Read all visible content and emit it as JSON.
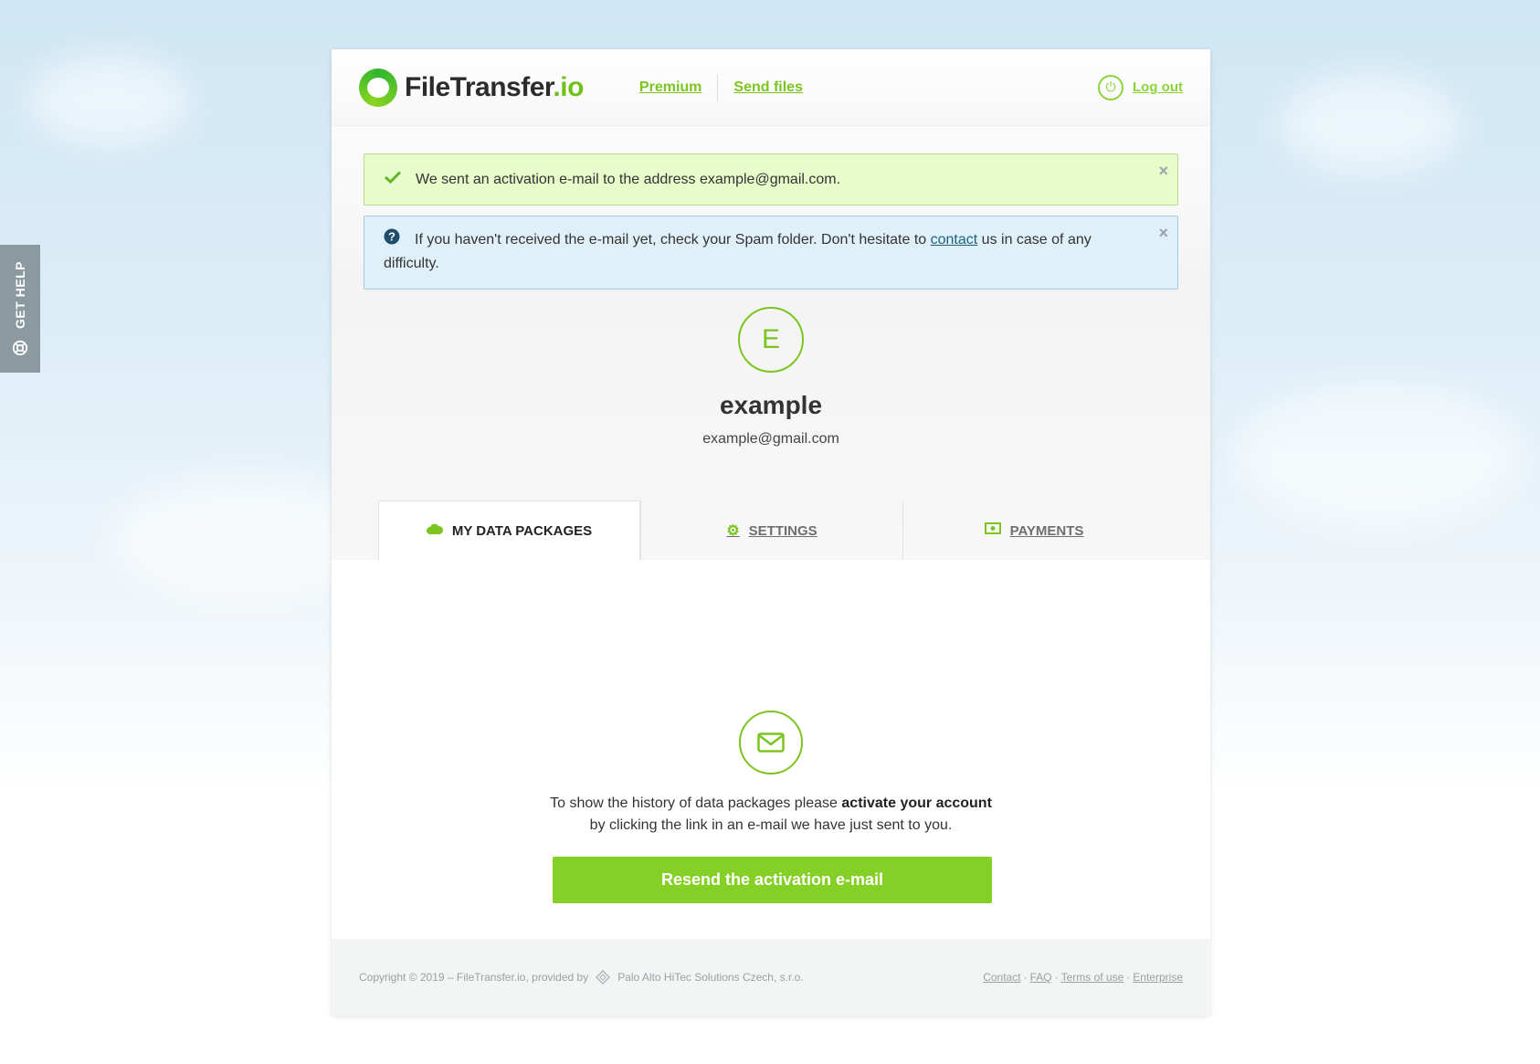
{
  "help_tab": {
    "label": "GET HELP"
  },
  "header": {
    "logo_main": "FileTransfer",
    "logo_suffix": ".io",
    "nav": {
      "premium": "Premium",
      "send_files": "Send files"
    },
    "logout": "Log out"
  },
  "alerts": {
    "success": {
      "text": "We sent an activation e-mail to the address example@gmail.com.",
      "close": "×"
    },
    "info": {
      "before": "If you haven't received the e-mail yet, check your Spam folder. Don't hesitate to ",
      "link": "contact",
      "after": " us in case of any difficulty.",
      "close": "×"
    }
  },
  "profile": {
    "initial": "E",
    "name": "example",
    "email": "example@gmail.com"
  },
  "tabs": [
    {
      "label": "MY DATA PACKAGES",
      "icon": "cloud-icon"
    },
    {
      "label": "SETTINGS",
      "icon": "gear-icon"
    },
    {
      "label": "PAYMENTS",
      "icon": "money-icon"
    }
  ],
  "content": {
    "line1_pre": "To show the history of data packages please ",
    "line1_bold": "activate your account",
    "line2": "by clicking the link in an e-mail we have just sent to you.",
    "button": "Resend the activation e-mail"
  },
  "footer": {
    "copyright": "Copyright © 2019 – FileTransfer.io, provided by",
    "partner": "Palo Alto HiTec Solutions Czech, s.r.o.",
    "links": [
      "Contact",
      "FAQ",
      "Terms of use",
      "Enterprise"
    ]
  },
  "colors": {
    "accent": "#84d026",
    "success_bg": "#e8fbca",
    "info_bg": "#e0f0f8",
    "help_tab": "#8b9aa1"
  }
}
